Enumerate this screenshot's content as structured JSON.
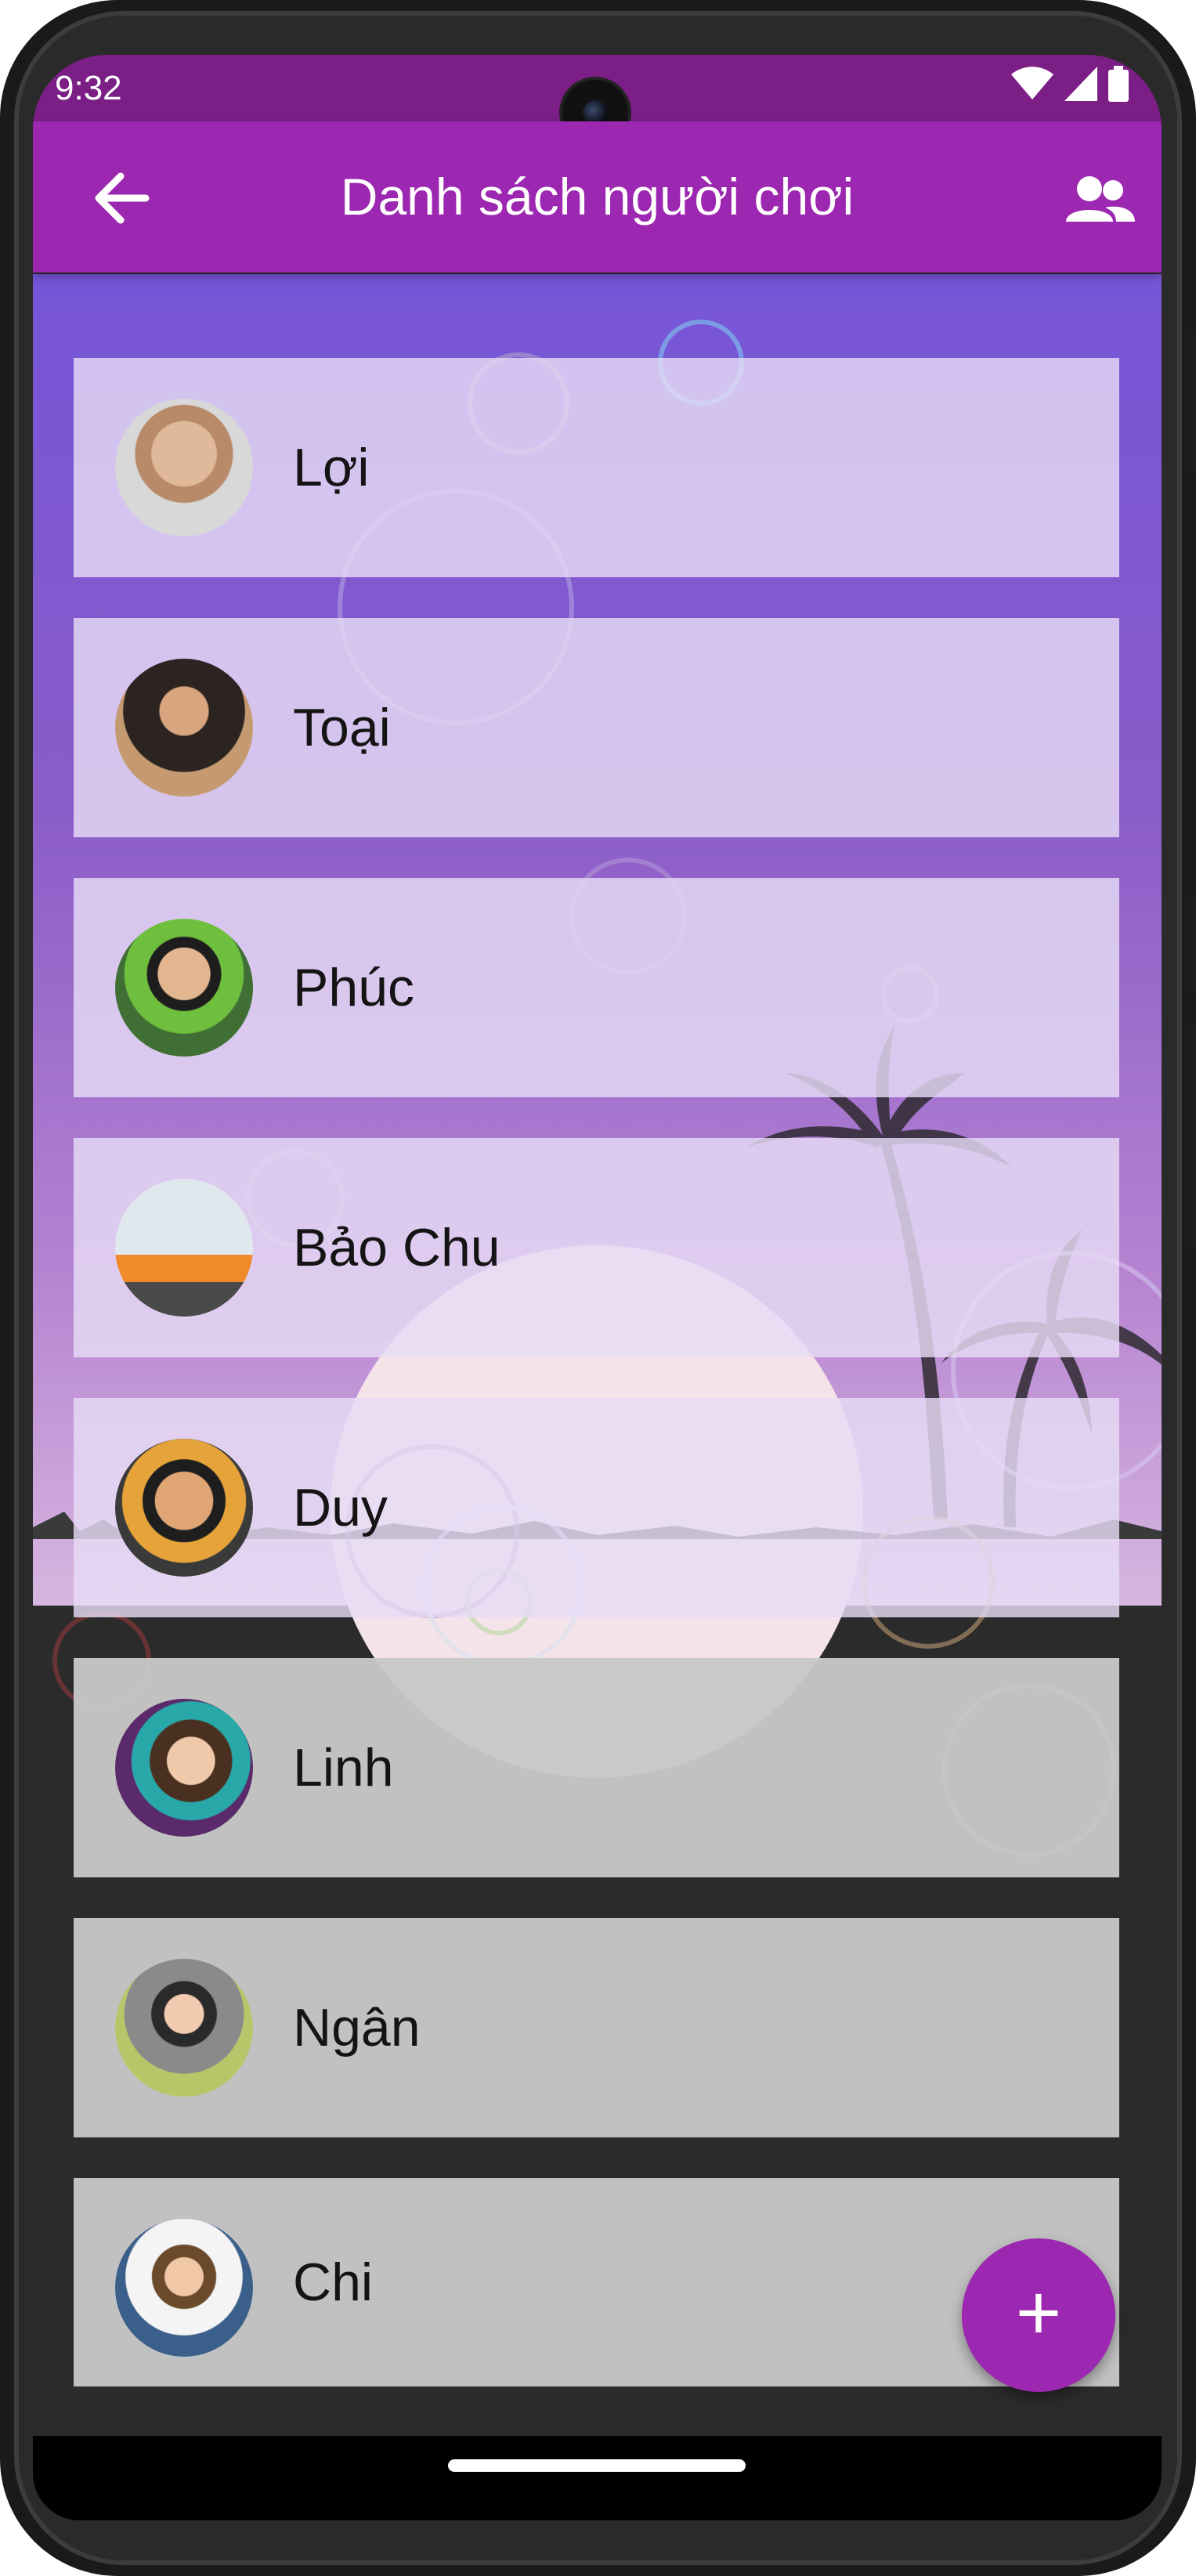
{
  "status_bar": {
    "time": "9:32"
  },
  "app_bar": {
    "title": "Danh sách người chơi"
  },
  "players": [
    {
      "name": "Lợi"
    },
    {
      "name": "Toại"
    },
    {
      "name": "Phúc"
    },
    {
      "name": "Bảo Chu"
    },
    {
      "name": "Duy"
    },
    {
      "name": "Linh"
    },
    {
      "name": "Ngân"
    },
    {
      "name": "Chi"
    }
  ],
  "fab": {
    "label": "+"
  },
  "colors": {
    "primary": "#9c27b0",
    "status_bar": "#7b1f86"
  },
  "icons": {
    "back": "arrow-back-icon",
    "people": "people-icon",
    "add": "plus-icon",
    "wifi": "wifi-icon",
    "signal": "signal-icon",
    "battery": "battery-icon"
  }
}
